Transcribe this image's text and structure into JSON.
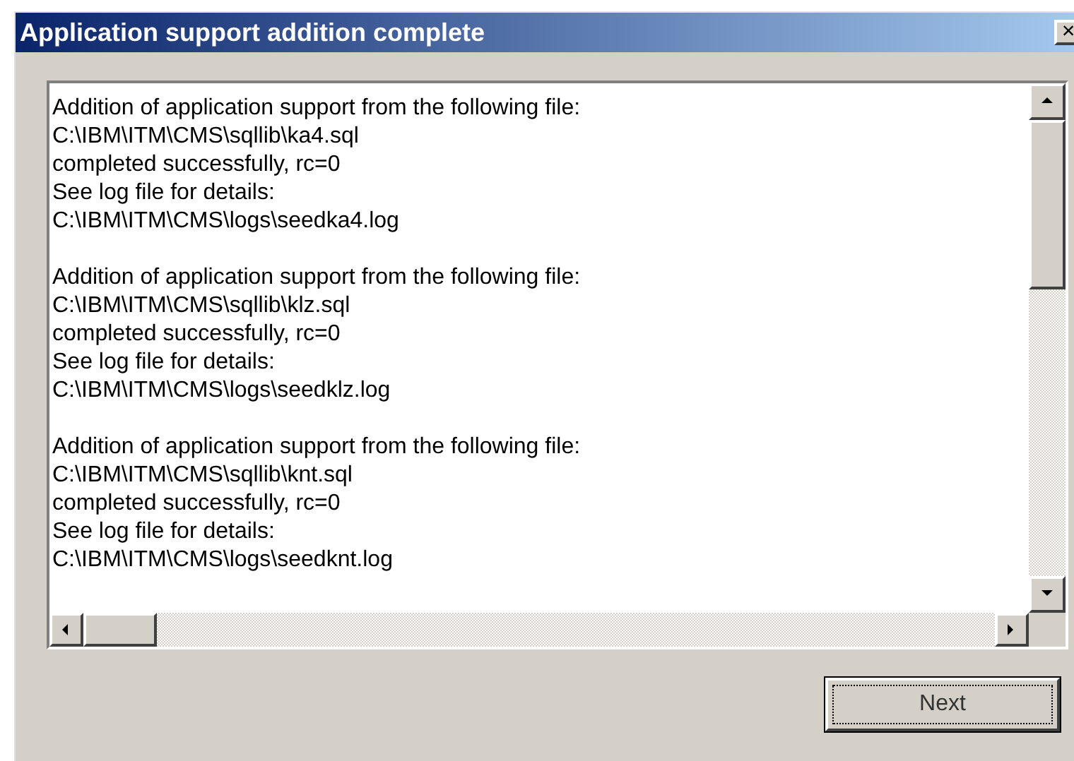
{
  "window": {
    "title": "Application support addition complete",
    "close": "×"
  },
  "log": [
    {
      "lines": [
        "Addition of application support from the following file:",
        "C:\\IBM\\ITM\\CMS\\sqllib\\ka4.sql",
        "completed successfully, rc=0",
        "See log file for details:",
        "C:\\IBM\\ITM\\CMS\\logs\\seedka4.log"
      ]
    },
    {
      "lines": [
        "Addition of application support from the following file:",
        "C:\\IBM\\ITM\\CMS\\sqllib\\klz.sql",
        "completed successfully, rc=0",
        "See log file for details:",
        "C:\\IBM\\ITM\\CMS\\logs\\seedklz.log"
      ]
    },
    {
      "lines": [
        "Addition of application support from the following file:",
        "C:\\IBM\\ITM\\CMS\\sqllib\\knt.sql",
        "completed successfully, rc=0",
        "See log file for details:",
        "C:\\IBM\\ITM\\CMS\\logs\\seedknt.log"
      ]
    }
  ],
  "buttons": [
    {
      "label": "Next",
      "focused": true
    }
  ]
}
